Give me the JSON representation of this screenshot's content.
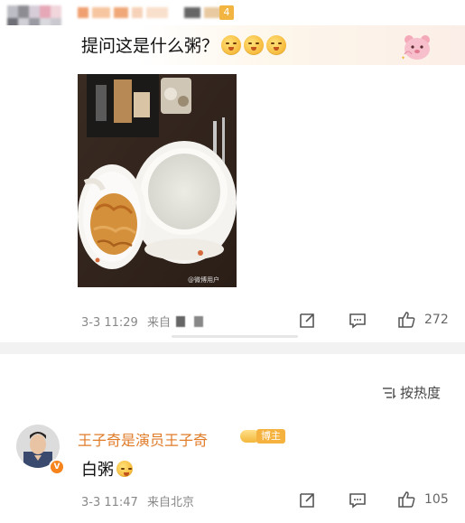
{
  "comment1": {
    "username_badge": "4",
    "text": "提问这是什么粥？",
    "emojis": [
      "yummy-face-emoji",
      "yummy-face-emoji",
      "yummy-face-emoji"
    ],
    "decoration": "pink-bear-sticker",
    "image": {
      "watermark": "@微博用户"
    },
    "timestamp": "3-3 11:29",
    "source": "来自",
    "actions": {
      "like_count": "272"
    }
  },
  "sort": {
    "label": "按热度"
  },
  "comment2": {
    "username": "王子奇是演员王子奇",
    "tag": "博主",
    "text": "白粥",
    "emoji": "yummy-face-emoji",
    "timestamp": "3-3 11:47",
    "source": "来自北京",
    "actions": {
      "like_count": "105"
    }
  },
  "colors": {
    "username": "#e07b28",
    "tag": "#f6b23f",
    "meta": "#888888"
  }
}
